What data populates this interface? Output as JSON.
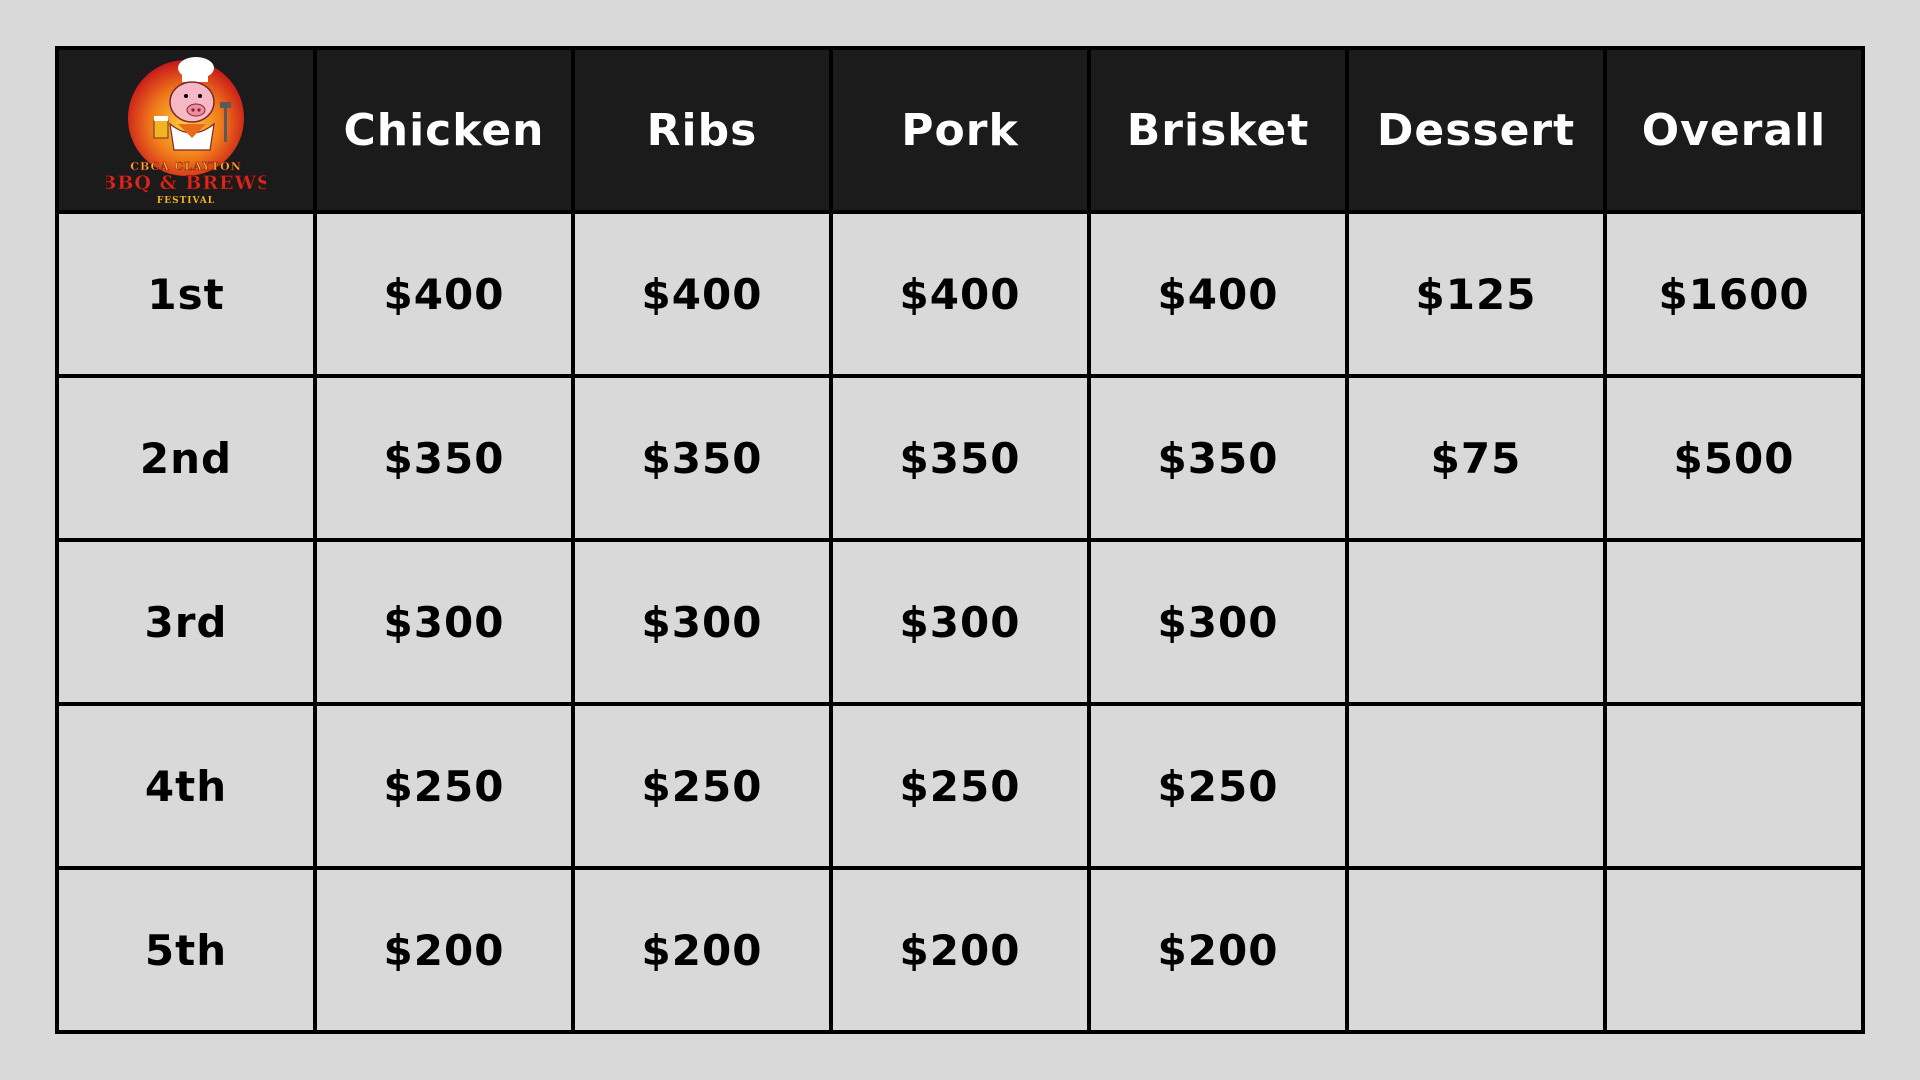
{
  "logo": {
    "name": "festival-pig-chef-logo",
    "line1": "CBCA CLAYTON",
    "line2": "BBQ & BREWS",
    "line3": "FESTIVAL"
  },
  "colors": {
    "background": "#d9d9d9",
    "header_bg": "#1b1b1b",
    "header_text": "#ffffff",
    "border": "#000000"
  },
  "columns": [
    "Chicken",
    "Ribs",
    "Pork",
    "Brisket",
    "Dessert",
    "Overall"
  ],
  "rows": [
    {
      "place": "1st",
      "values": [
        "$400",
        "$400",
        "$400",
        "$400",
        "$125",
        "$1600"
      ]
    },
    {
      "place": "2nd",
      "values": [
        "$350",
        "$350",
        "$350",
        "$350",
        "$75",
        "$500"
      ]
    },
    {
      "place": "3rd",
      "values": [
        "$300",
        "$300",
        "$300",
        "$300",
        "",
        ""
      ]
    },
    {
      "place": "4th",
      "values": [
        "$250",
        "$250",
        "$250",
        "$250",
        "",
        ""
      ]
    },
    {
      "place": "5th",
      "values": [
        "$200",
        "$200",
        "$200",
        "$200",
        "",
        ""
      ]
    }
  ]
}
